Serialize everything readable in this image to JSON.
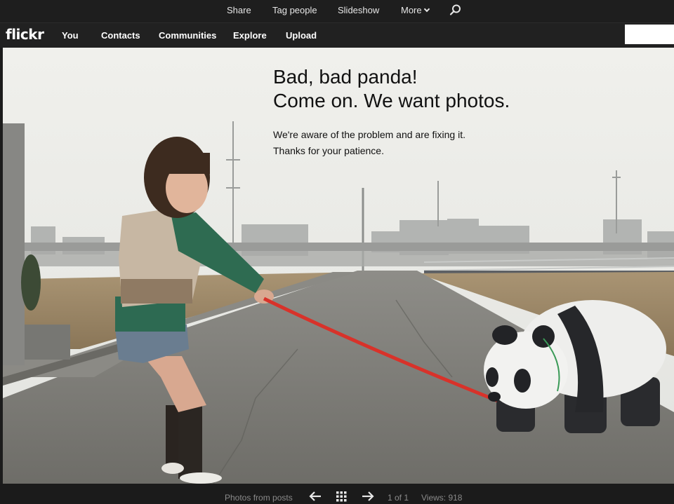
{
  "actionbar": {
    "share": "Share",
    "tag_people": "Tag people",
    "slideshow": "Slideshow",
    "more": "More"
  },
  "globalnav": {
    "logo": "flickr",
    "items": [
      "You",
      "Contacts",
      "Communities",
      "Explore",
      "Upload"
    ],
    "search_value": ""
  },
  "message": {
    "heading_line1": "Bad, bad panda!",
    "heading_line2": "Come on. We want photos.",
    "body_line1": "We're aware of the problem and are fixing it.",
    "body_line2": "Thanks for your patience."
  },
  "bottombar": {
    "photos_from_posts": "Photos from posts",
    "counter": "1 of 1",
    "views": "Views: 918"
  },
  "icons": {
    "search": "search-icon",
    "prev": "arrow-left-icon",
    "grid": "grid-icon",
    "next": "arrow-right-icon",
    "more_caret": "chevron-down-icon"
  },
  "colors": {
    "chrome_bg": "#1e1e1e",
    "nav_text": "#ffffff",
    "bottom_text": "#8a8a8a",
    "leash": "#d8322a"
  }
}
